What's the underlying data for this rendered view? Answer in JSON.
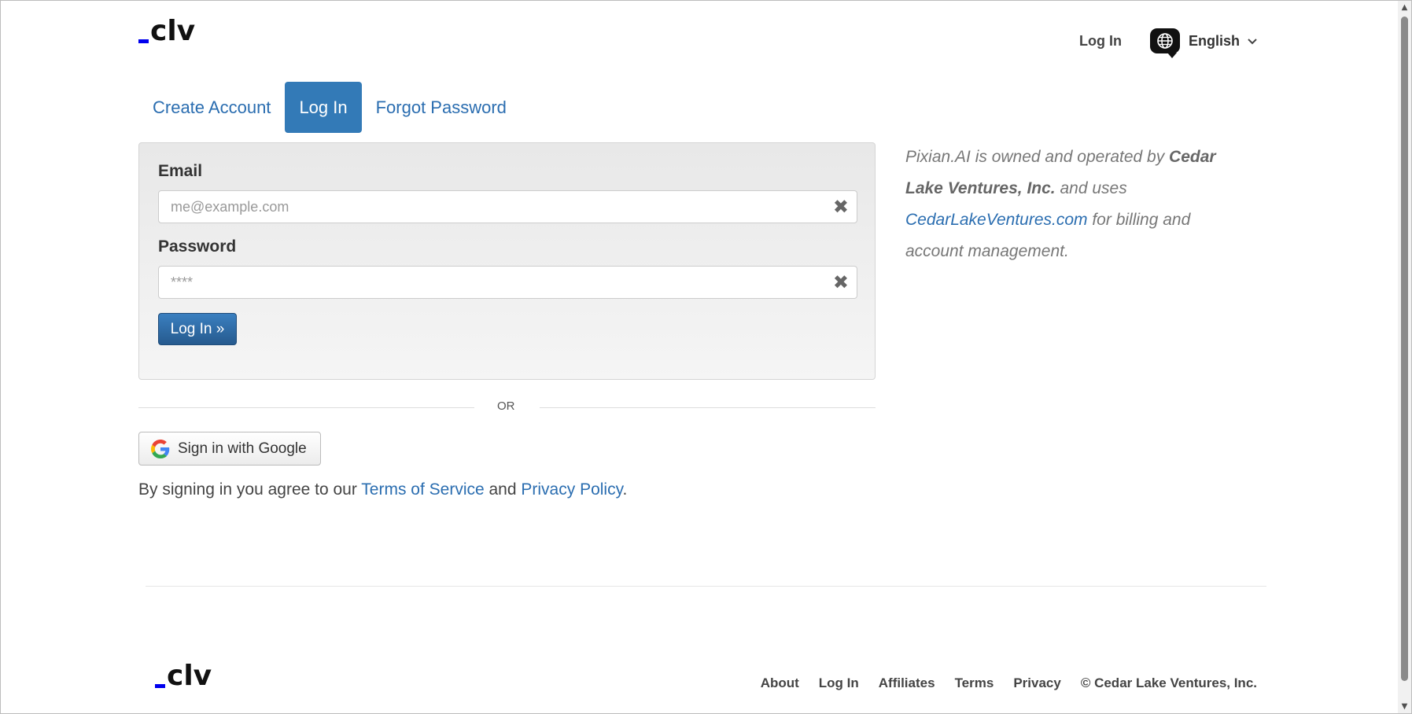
{
  "header": {
    "logo_text": "clv",
    "login_label": "Log In",
    "language_label": "English"
  },
  "tabs": [
    {
      "label": "Create Account",
      "active": false
    },
    {
      "label": "Log In",
      "active": true
    },
    {
      "label": "Forgot Password",
      "active": false
    }
  ],
  "form": {
    "email_label": "Email",
    "email_placeholder": "me@example.com",
    "email_value": "",
    "password_label": "Password",
    "password_placeholder": "****",
    "password_value": "",
    "submit_label": "Log In »"
  },
  "divider_text": "OR",
  "google_label": "Sign in with Google",
  "agreement": {
    "prefix": "By signing in you agree to our ",
    "terms_label": "Terms of Service",
    "middle": " and ",
    "privacy_label": "Privacy Policy",
    "suffix": "."
  },
  "side_note": {
    "part1": "Pixian.AI is owned and operated by ",
    "company": "Cedar Lake Ventures, Inc.",
    "part2": " and uses ",
    "link": "CedarLakeVentures.com",
    "part3": " for billing and account management."
  },
  "footer": {
    "logo_text": "clv",
    "links": [
      "About",
      "Log In",
      "Affiliates",
      "Terms",
      "Privacy"
    ],
    "copyright": "© Cedar Lake Ventures, Inc."
  },
  "colors": {
    "accent": "#337ab7",
    "link": "#2a6db0",
    "logo_dash": "#0000ee"
  },
  "icons": [
    "globe-icon",
    "chevron-down-icon",
    "clear-icon",
    "google-icon"
  ]
}
